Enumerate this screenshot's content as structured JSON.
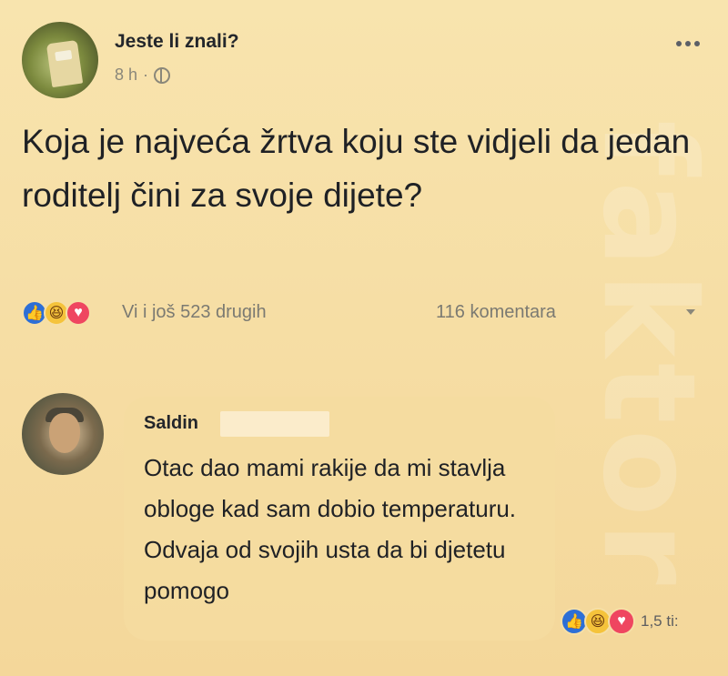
{
  "post": {
    "page_name": "Jeste li znali?",
    "time": "8 h",
    "separator": "·",
    "privacy_icon": "globe-icon",
    "more_icon": "more-dots-icon",
    "text": "Koja je najveća žrtva koju ste vidjeli da jedan roditelj čini za svoje dijete?"
  },
  "engagement": {
    "reaction_icons": [
      "like-icon",
      "haha-icon",
      "love-icon"
    ],
    "reactors_text": "Vi i još 523 drugih",
    "comments_text": "116 komentara"
  },
  "comment": {
    "author": "Saldin",
    "text": "Otac dao mami rakije da mi stavlja obloge kad sam dobio temperaturu. Odvaja od svojih usta da bi djetetu pomogo",
    "reaction_icons": [
      "like-icon",
      "haha-icon",
      "love-icon"
    ],
    "reaction_count": "1,5 ti:"
  },
  "watermark": {
    "text": "faktor"
  },
  "colors": {
    "background": "#f6dfa6",
    "like": "#2d6fd6",
    "haha": "#f5c33b",
    "love": "#ef4660"
  }
}
